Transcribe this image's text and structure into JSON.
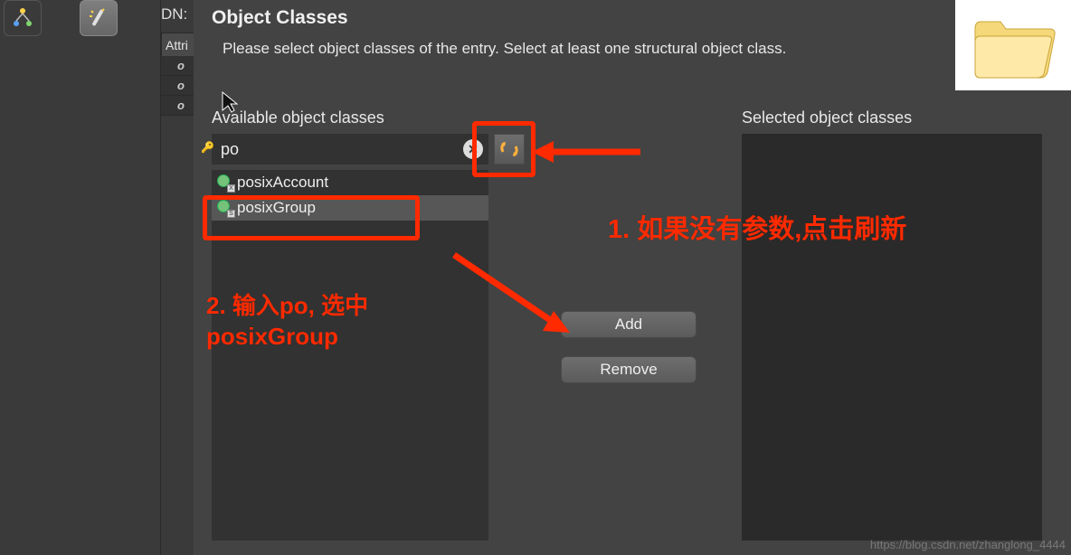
{
  "background": {
    "dn_label": "DN:",
    "attr_tab": "Attri",
    "rows": [
      "o",
      "o",
      "o"
    ]
  },
  "dialog": {
    "title": "Object Classes",
    "subtitle": "Please select object classes of the entry. Select at least one structural object class.",
    "available_label": "Available object classes",
    "selected_label": "Selected object classes",
    "search_value": "po",
    "items": [
      {
        "label": "posixAccount",
        "badge": "X"
      },
      {
        "label": "posixGroup",
        "badge": "S"
      }
    ],
    "add_label": "Add",
    "remove_label": "Remove"
  },
  "annotations": {
    "t1": "1. 如果没有参数,点击刷新",
    "t2_l1": "2. 输入po, 选中",
    "t2_l2": "posixGroup"
  },
  "watermark": "https://blog.csdn.net/zhanglong_4444"
}
